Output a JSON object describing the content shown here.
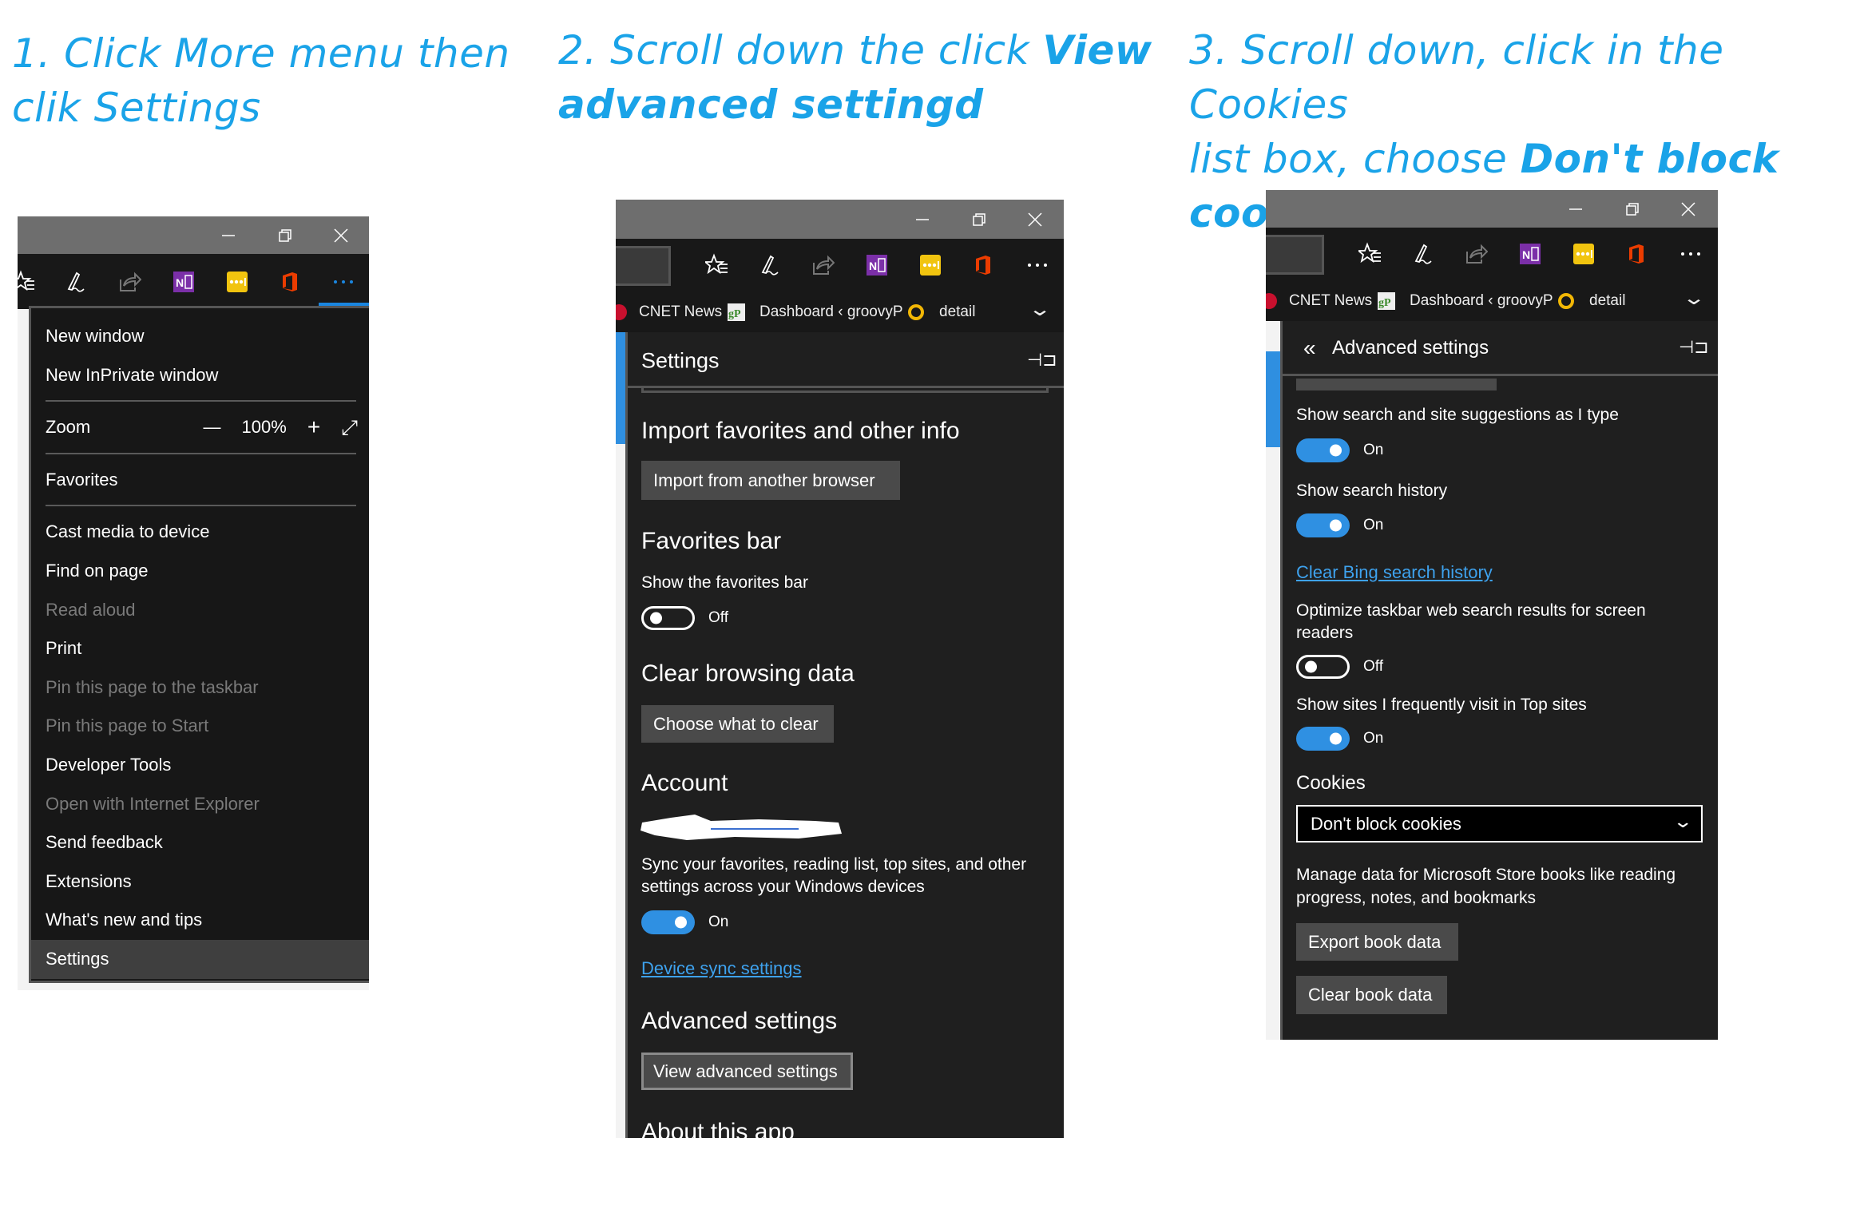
{
  "steps": [
    {
      "lines": [
        [
          {
            "text": "1. Click More menu then",
            "bold": false
          }
        ],
        [
          {
            "text": "clik Settings",
            "bold": false
          }
        ]
      ]
    },
    {
      "lines": [
        [
          {
            "text": "2. Scroll down the click ",
            "bold": false
          },
          {
            "text": "View",
            "bold": true
          }
        ],
        [
          {
            "text": "advanced settingd",
            "bold": true
          }
        ]
      ]
    },
    {
      "lines": [
        [
          {
            "text": "3. Scroll down, click in the Cookies",
            "bold": false
          }
        ],
        [
          {
            "text": "list box, choose ",
            "bold": false
          },
          {
            "text": "Don't block cookies",
            "bold": true
          }
        ]
      ]
    }
  ],
  "colors": {
    "accent": "#1aa3e8",
    "toggle_on": "#2f90e2",
    "link": "#3ea2ee",
    "panel_bg": "#1f1f1f",
    "titlebar": "#6e6e6e"
  },
  "toolbar_icons": [
    "favorites-hub-icon",
    "web-note-pen-icon",
    "share-icon",
    "onenote-icon",
    "lastpass-icon",
    "office-icon",
    "more-dots-icon"
  ],
  "favorites_bar": [
    {
      "label": "CNET News",
      "icon": "cnet-icon"
    },
    {
      "label": "Dashboard ‹ groovyP",
      "icon": "groovypost-icon"
    },
    {
      "label": "detail",
      "icon": "norton-icon"
    }
  ],
  "menu": {
    "items_a": [
      "New window",
      "New InPrivate window"
    ],
    "zoom_label": "Zoom",
    "zoom_value": "100%",
    "favorites": "Favorites",
    "items_b": [
      {
        "label": "Cast media to device",
        "disabled": false
      },
      {
        "label": "Find on page",
        "disabled": false
      },
      {
        "label": "Read aloud",
        "disabled": true
      },
      {
        "label": "Print",
        "disabled": false
      },
      {
        "label": "Pin this page to the taskbar",
        "disabled": true
      },
      {
        "label": "Pin this page to Start",
        "disabled": true
      },
      {
        "label": "Developer Tools",
        "disabled": false
      },
      {
        "label": "Open with Internet Explorer",
        "disabled": true
      },
      {
        "label": "Send feedback",
        "disabled": false
      },
      {
        "label": "Extensions",
        "disabled": false
      },
      {
        "label": "What's new and tips",
        "disabled": false
      },
      {
        "label": "Settings",
        "disabled": false,
        "selected": true
      }
    ]
  },
  "settings": {
    "title": "Settings",
    "import_heading": "Import favorites and other info",
    "import_button": "Import from another browser",
    "favbar_heading": "Favorites bar",
    "favbar_label": "Show the favorites bar",
    "favbar_toggle": "Off",
    "clear_heading": "Clear browsing data",
    "clear_button": "Choose what to clear",
    "account_heading": "Account",
    "sync_text_1": "Sync your favorites, reading list, top sites, and other",
    "sync_text_2": "settings across your Windows devices",
    "sync_toggle": "On",
    "sync_link": "Device sync settings",
    "advanced_heading": "Advanced settings",
    "advanced_button": "View advanced settings",
    "about_heading": "About this app"
  },
  "advanced": {
    "title": "Advanced settings",
    "suggest_label": "Show search and site suggestions as I type",
    "suggest_toggle": "On",
    "history_label": "Show search history",
    "history_toggle": "On",
    "clear_bing_link": "Clear Bing search history",
    "optimize_1": "Optimize taskbar web search results for screen",
    "optimize_2": "readers",
    "optimize_toggle": "Off",
    "topsites_label": "Show sites I frequently visit in Top sites",
    "topsites_toggle": "On",
    "cookies_label": "Cookies",
    "cookies_value": "Don't block cookies",
    "books_1": "Manage data for Microsoft Store books like reading",
    "books_2": "progress, notes, and bookmarks",
    "export_button": "Export book data",
    "clear_book_button": "Clear book data"
  }
}
